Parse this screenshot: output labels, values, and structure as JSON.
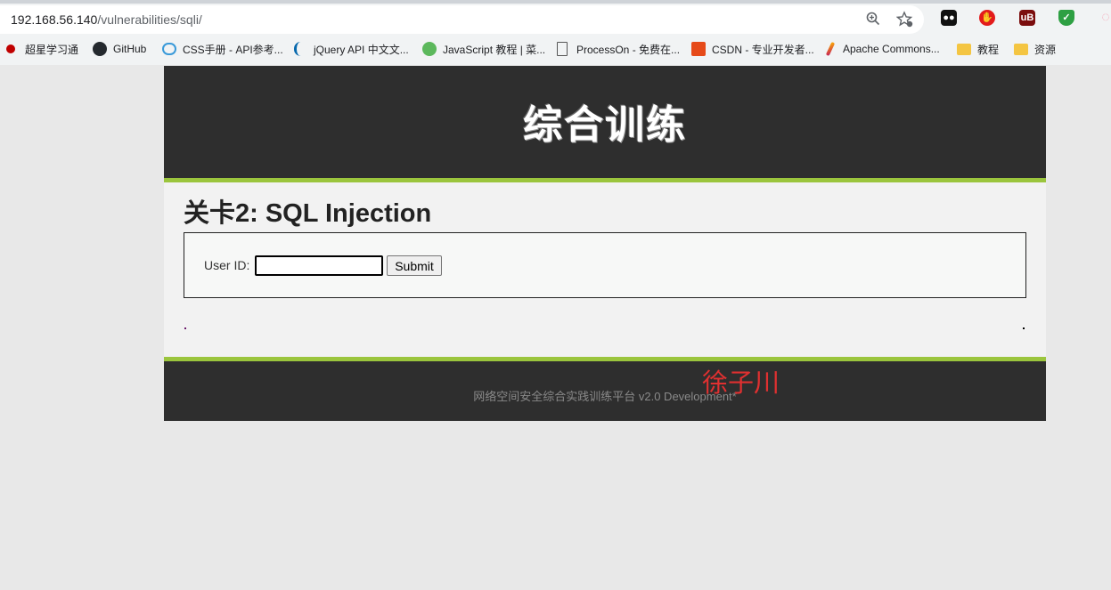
{
  "browser": {
    "url_host": "192.168.56.140",
    "url_path": "/vulnerabilities/sqli/",
    "bookmarks": [
      {
        "label": "超星学习通",
        "color": "#c00000"
      },
      {
        "label": "GitHub",
        "color": "#24292e"
      },
      {
        "label": "CSS手册 - API参考...",
        "color": "#3a9ad9"
      },
      {
        "label": "jQuery API 中文文...",
        "color": "#0769ad"
      },
      {
        "label": "JavaScript 教程 | 菜...",
        "color": "#5cb85c"
      },
      {
        "label": "ProcessOn - 免费在...",
        "color": "#777777"
      },
      {
        "label": "CSDN - 专业开发者...",
        "color": "#e64a19"
      },
      {
        "label": "Apache Commons...",
        "color": "#c2185b"
      },
      {
        "label": "教程",
        "color": "#f4c542"
      },
      {
        "label": "资源",
        "color": "#f4c542"
      }
    ],
    "extensions": [
      {
        "name": "tampermonkey-icon",
        "color": "#111111",
        "glyph": "●●"
      },
      {
        "name": "adblock-icon",
        "color": "#e31b1b",
        "glyph": "✋"
      },
      {
        "name": "ublock-icon",
        "color": "#7b0d0d",
        "glyph": "uB"
      },
      {
        "name": "shield-icon",
        "color": "#2ea043",
        "glyph": "✓"
      }
    ]
  },
  "page": {
    "logo": "综合训练",
    "title": "关卡2: SQL Injection",
    "form": {
      "user_id_label": "User ID:",
      "user_id_value": "",
      "submit_label": "Submit"
    },
    "footer": "网络空间安全综合实践训练平台 v2.0 Development*",
    "watermark": "徐子川"
  }
}
